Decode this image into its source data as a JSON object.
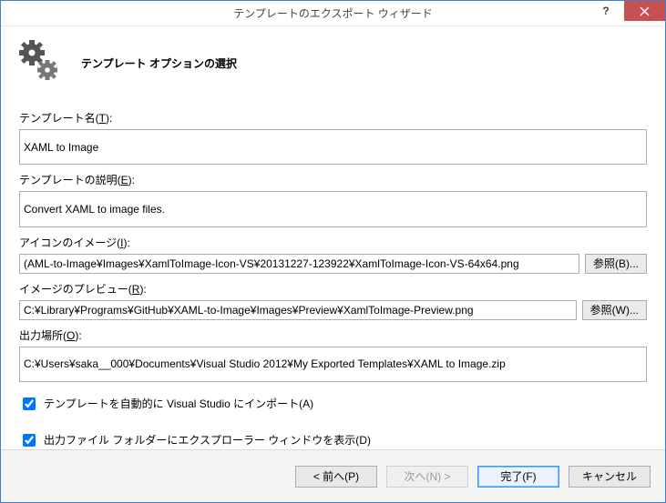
{
  "window": {
    "title": "テンプレートのエクスポート ウィザード"
  },
  "header": {
    "subtitle": "テンプレート オプションの選択"
  },
  "fields": {
    "name": {
      "label": "テンプレート名(",
      "accel": "T",
      "label_end": "):",
      "value": "XAML to Image"
    },
    "desc": {
      "label": "テンプレートの説明(",
      "accel": "E",
      "label_end": "):",
      "value": "Convert XAML to image files."
    },
    "icon": {
      "label": "アイコンのイメージ(",
      "accel": "I",
      "label_end": "):",
      "value": "(AML-to-Image¥Images¥XamlToImage-Icon-VS¥20131227-123922¥XamlToImage-Icon-VS-64x64.png",
      "browse": "参照(",
      "browse_accel": "B",
      "browse_end": ")..."
    },
    "preview": {
      "label": "イメージのプレビュー(",
      "accel": "R",
      "label_end": "):",
      "value": "C:¥Library¥Programs¥GitHub¥XAML-to-Image¥Images¥Preview¥XamlToImage-Preview.png",
      "browse": "参照(",
      "browse_accel": "W",
      "browse_end": ")..."
    },
    "output": {
      "label": "出力場所(",
      "accel": "O",
      "label_end": "):",
      "value": "C:¥Users¥saka__000¥Documents¥Visual Studio 2012¥My Exported Templates¥XAML to Image.zip"
    }
  },
  "checks": {
    "import": {
      "label": "テンプレートを自動的に Visual Studio にインポート(",
      "accel": "A",
      "label_end": ")",
      "checked": true
    },
    "explorer": {
      "label": "出力ファイル フォルダーにエクスプローラー ウィンドウを表示(",
      "accel": "D",
      "label_end": ")",
      "checked": true
    }
  },
  "footer": {
    "back": "< 前へ(P)",
    "next": "次へ(N) >",
    "finish": "完了(F)",
    "cancel": "キャンセル"
  }
}
